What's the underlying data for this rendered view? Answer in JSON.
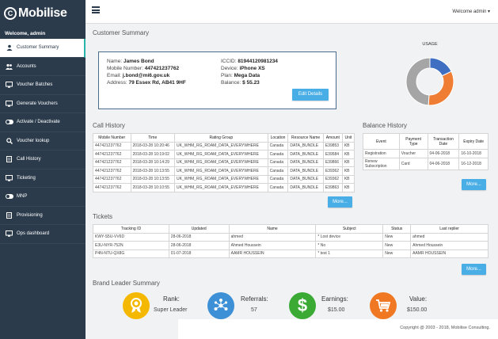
{
  "app": {
    "brand": "Mobilise",
    "logo_mark": "C"
  },
  "sidebar": {
    "welcome": "Welcome, admin",
    "items": [
      {
        "label": "Customer Summary",
        "icon": "user-icon",
        "active": true
      },
      {
        "label": "Accounts",
        "icon": "users-icon"
      },
      {
        "label": "Voucher Batches",
        "icon": "monitor-icon"
      },
      {
        "label": "Generate Vouchers",
        "icon": "monitor-icon"
      },
      {
        "label": "Activate / Deactivate",
        "icon": "toggle-icon"
      },
      {
        "label": "Voucher lookup",
        "icon": "search-icon"
      },
      {
        "label": "Call History",
        "icon": "document-icon"
      },
      {
        "label": "Ticketing",
        "icon": "ticket-icon"
      },
      {
        "label": "MNP",
        "icon": "toggle-icon"
      },
      {
        "label": "Provisioning",
        "icon": "document-icon"
      },
      {
        "label": "Ops dashboard",
        "icon": "monitor-icon"
      }
    ]
  },
  "topbar": {
    "user_menu": "Welcome admin ▾"
  },
  "customer": {
    "title": "Customer Summary",
    "name_label": "Name:",
    "name": "James Bond",
    "mobile_label": "Mobile Number:",
    "mobile": "447421237762",
    "email_label": "Email:",
    "email": "j.bond@mi6.gov.uk",
    "address_label": "Address:",
    "address": "79 Essex Rd, AB41 9HF",
    "iccid_label": "ICCID:",
    "iccid": "81944120981234",
    "device_label": "Device:",
    "device": "iPhone XS",
    "plan_label": "Plan:",
    "plan": "Mega Data",
    "balance_label": "Balance:",
    "balance": "$ 55.23",
    "edit_button": "Edit Details"
  },
  "usage": {
    "label": "USAGE",
    "segments": [
      {
        "value": 0.18,
        "color": "#3f6fc1"
      },
      {
        "value": 0.33,
        "color": "#ef7d33"
      },
      {
        "value": 0.49,
        "color": "#a5a5a5"
      }
    ]
  },
  "call_history": {
    "title": "Call History",
    "columns": [
      "Mobile Number",
      "Time",
      "Rating Group",
      "Location",
      "Resource Name",
      "Amount",
      "Unit"
    ],
    "rows": [
      [
        "447421237762",
        "2018-03-28 10:20:46",
        "UK_WHM_RG_ROAM_DATA_EVERYWHERE",
        "Canada",
        "DATA_BUNDLE",
        "E39853",
        "KB"
      ],
      [
        "447421237762",
        "2018-03-28 10:19:02",
        "UK_WHM_RG_ROAM_DATA_EVERYWHERE",
        "Canada",
        "DATA_BUNDLE",
        "E39584",
        "KB"
      ],
      [
        "447421237762",
        "2018-03-28 10:14:29",
        "UK_WHM_RG_ROAM_DATA_EVERYWHERE",
        "Canada",
        "DATA_BUNDLE",
        "E39866",
        "KB"
      ],
      [
        "447421237762",
        "2018-03-28 10:13:55",
        "UK_WHM_RG_ROAM_DATA_EVERYWHERE",
        "Canada",
        "DATA_BUNDLE",
        "E39362",
        "KB"
      ],
      [
        "447421237762",
        "2018-03-28 10:13:55",
        "UK_WHM_RG_ROAM_DATA_EVERYWHERE",
        "Canada",
        "DATA_BUNDLE",
        "E39362",
        "KB"
      ],
      [
        "447421237762",
        "2018-03-28 10:10:55",
        "UK_WHM_RG_ROAM_DATA_EVERYWHERE",
        "Canada",
        "DATA_BUNDLE",
        "E39863",
        "KB"
      ]
    ],
    "more_button": "More..."
  },
  "balance_history": {
    "title": "Balance History",
    "columns": [
      "Event",
      "Payment Type",
      "Transaction Date",
      "Expiry Date"
    ],
    "rows": [
      [
        "Registration",
        "Voucher",
        "04-06-2018",
        "16-10-2018"
      ],
      [
        "Renew Subscription",
        "Card",
        "04-06-2018",
        "16-12-2018"
      ]
    ],
    "more_button": "More..."
  },
  "tickets": {
    "title": "Tickets",
    "columns": [
      "Tracking ID",
      "Updated",
      "Name",
      "Subject",
      "Status",
      "Last replier"
    ],
    "rows": [
      [
        "KWY-S5U-VV6D",
        "28-06-2018",
        "ahmed",
        "* Lost device",
        "New",
        "ahmed"
      ],
      [
        "E3U-NYR-752N",
        "28-06-2018",
        "Ahmed Houssein",
        "* No",
        "New",
        "Ahmed Houssein"
      ],
      [
        "P4N-NTU-QX8G",
        "01-07-2018",
        "AAMR HOUSSEIN",
        "* test 1",
        "New",
        "AAMR HOUSSEIN"
      ]
    ],
    "more_button": "More..."
  },
  "brand_leader": {
    "title": "Brand Leader Summary",
    "items": [
      {
        "label": "Rank:",
        "value": "Super Leader",
        "icon": "award-icon",
        "color": "#f5b800"
      },
      {
        "label": "Referrals:",
        "value": "57",
        "icon": "network-icon",
        "color": "#3d8fd6"
      },
      {
        "label": "Earnings:",
        "value": "$15.00",
        "icon": "dollar-icon",
        "color": "#3aaa35"
      },
      {
        "label": "Value:",
        "value": "$150.00",
        "icon": "cart-icon",
        "color": "#f07822"
      }
    ]
  },
  "footer": {
    "copyright": "Copyright @ 2003 - 2018, Mobilise Consulting."
  }
}
